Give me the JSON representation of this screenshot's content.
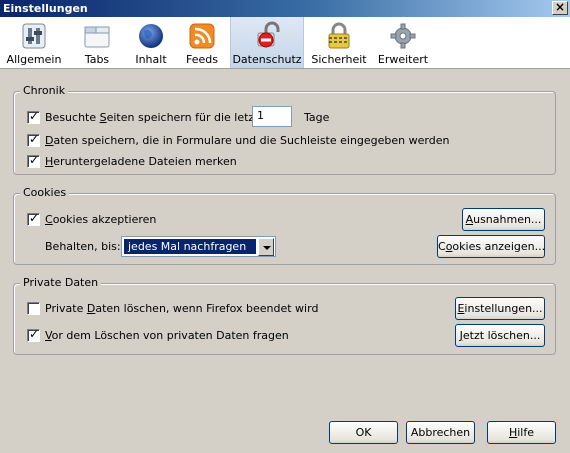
{
  "window": {
    "title": "Einstellungen",
    "close_glyph": "×"
  },
  "toolbar": {
    "items": [
      {
        "label": "Allgemein",
        "icon": "switch-icon"
      },
      {
        "label": "Tabs",
        "icon": "tabs-window-icon"
      },
      {
        "label": "Inhalt",
        "icon": "globe-icon"
      },
      {
        "label": "Feeds",
        "icon": "rss-feed-icon"
      },
      {
        "label": "Datenschutz",
        "icon": "privacy-lock-icon",
        "selected": true
      },
      {
        "label": "Sicherheit",
        "icon": "padlock-icon"
      },
      {
        "label": "Erweitert",
        "icon": "gear-icon"
      }
    ]
  },
  "chronik": {
    "title": "Chronik",
    "history_prefix": "Besuchte ",
    "history_accel": "S",
    "history_rest": "eiten speichern für die letzten",
    "history_checked": true,
    "history_days": "1",
    "history_suffix": "Tage",
    "forms_accel": "D",
    "forms_rest": "aten speichern, die in Formulare und die Suchleiste eingegeben werden",
    "forms_checked": true,
    "downloads_accel": "H",
    "downloads_rest": "eruntergeladene Dateien merken",
    "downloads_checked": true
  },
  "cookies": {
    "title": "Cookies",
    "accept_accel": "C",
    "accept_rest": "ookies akzeptieren",
    "accept_checked": true,
    "exceptions_accel": "A",
    "exceptions_rest": "usnahmen...",
    "keep_label": "Behalten, bis:",
    "keep_value": "jedes Mal nachfragen",
    "show_pre": "C",
    "show_accel": "o",
    "show_rest": "okies anzeigen..."
  },
  "private": {
    "title": "Private Daten",
    "clear_pre": "Private ",
    "clear_accel": "D",
    "clear_rest": "aten löschen, wenn Firefox beendet wird",
    "clear_checked": false,
    "settings_accel": "E",
    "settings_rest": "instellungen...",
    "ask_accel": "V",
    "ask_rest": "or dem Löschen von privaten Daten fragen",
    "ask_checked": true,
    "clear_now_accel": "J",
    "clear_now_rest": "etzt löschen..."
  },
  "footer": {
    "ok": "OK",
    "cancel": "Abbrechen",
    "help_accel": "H",
    "help_rest": "ilfe"
  },
  "check_glyph": "✓"
}
